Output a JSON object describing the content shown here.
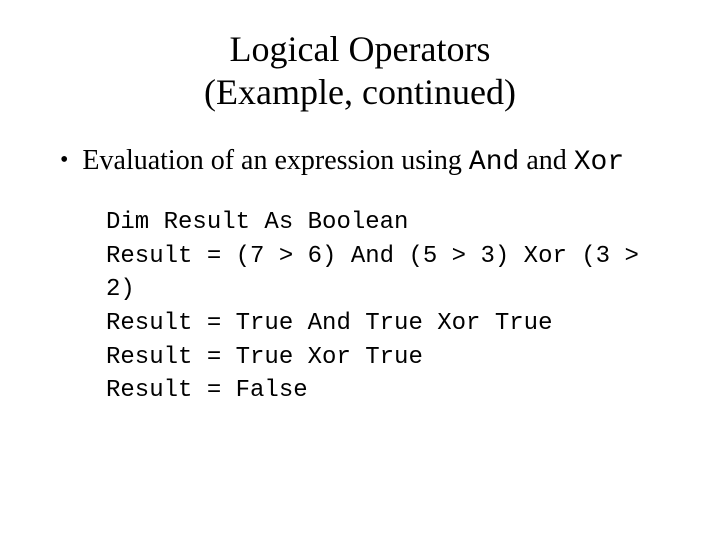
{
  "title_line1": "Logical Operators",
  "title_line2": "(Example, continued)",
  "bullet": {
    "pre": "Evaluation of an expression using ",
    "kw1": "And",
    "mid": " and ",
    "kw2": "Xor"
  },
  "code": {
    "l1": "Dim Result As Boolean",
    "l2": "Result = (7 > 6) And (5 > 3) Xor (3 > 2)",
    "l3": "Result = True And True Xor True",
    "l4": "Result = True Xor True",
    "l5": "Result = False"
  }
}
